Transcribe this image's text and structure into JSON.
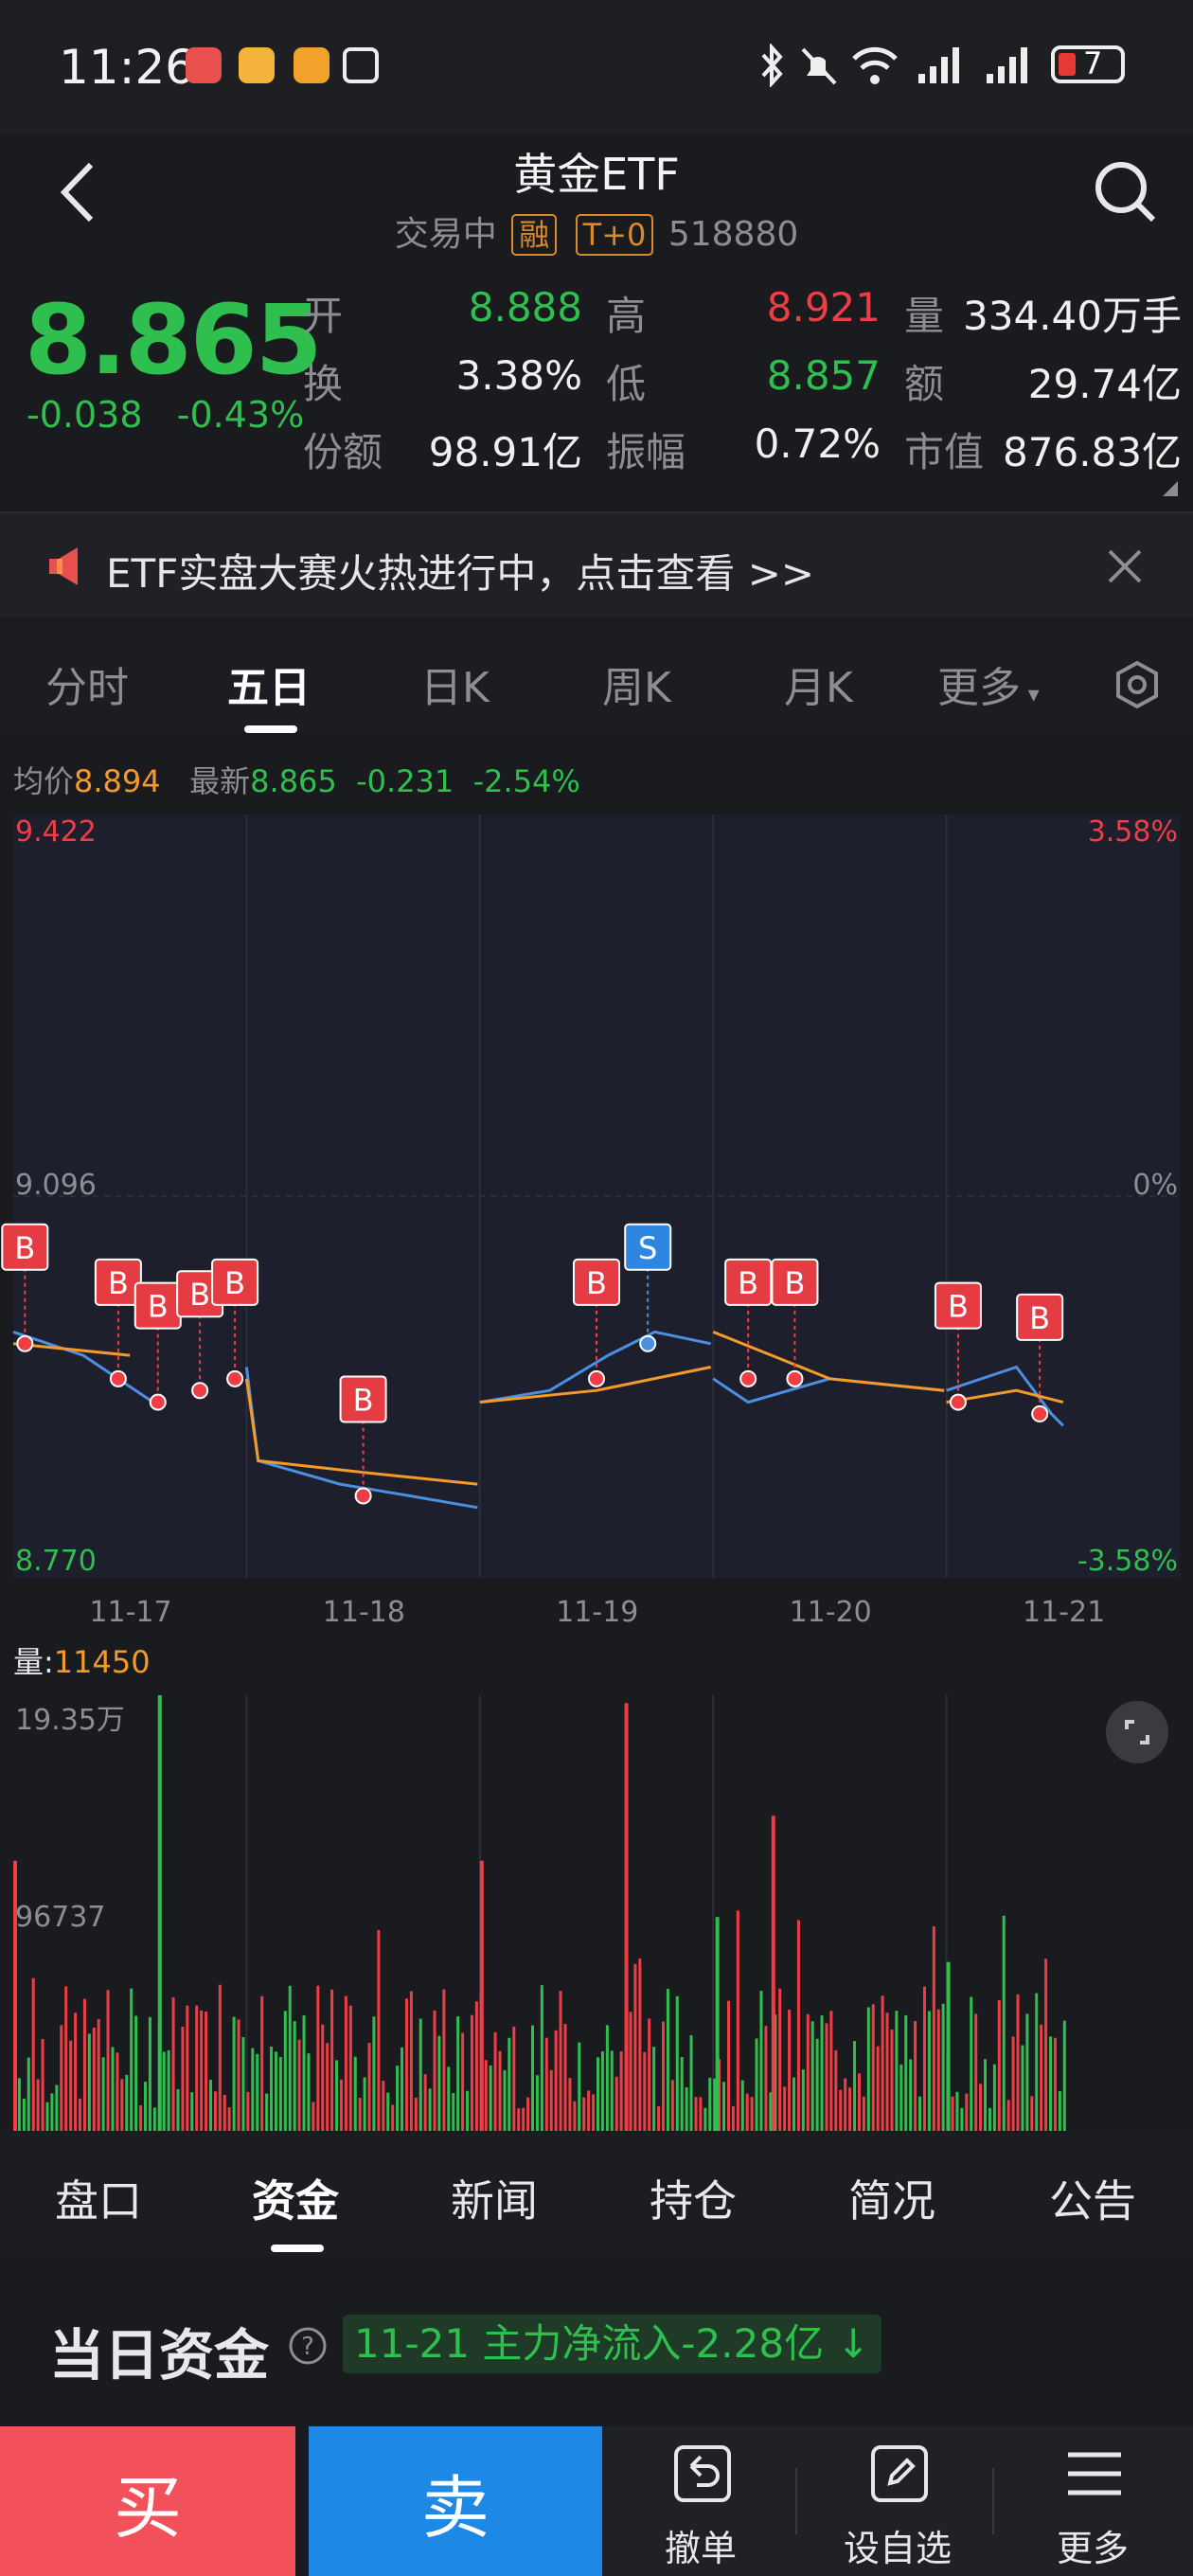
{
  "status_bar": {
    "time": "11:26",
    "battery": "7"
  },
  "header": {
    "title": "黄金ETF",
    "status": "交易中",
    "tag_margin": "融",
    "tag_t0": "T+0",
    "code": "518880"
  },
  "quote": {
    "price": "8.865",
    "change": "-0.038",
    "change_pct": "-0.43%",
    "fields": [
      {
        "label": "开",
        "value": "8.888",
        "color": "green"
      },
      {
        "label": "高",
        "value": "8.921",
        "color": "red"
      },
      {
        "label": "量",
        "value": "334.40万手",
        "color": "white"
      },
      {
        "label": "换",
        "value": "3.38%",
        "color": "white"
      },
      {
        "label": "低",
        "value": "8.857",
        "color": "green"
      },
      {
        "label": "额",
        "value": "29.74亿",
        "color": "white"
      },
      {
        "label": "份额",
        "value": "98.91亿",
        "color": "white"
      },
      {
        "label": "振幅",
        "value": "0.72%",
        "color": "white"
      },
      {
        "label": "市值",
        "value": "876.83亿",
        "color": "white"
      }
    ]
  },
  "banner": {
    "text": "ETF实盘大赛火热进行中，点击查看 >>"
  },
  "chart_tabs": [
    "分时",
    "五日",
    "日K",
    "周K",
    "月K",
    "更多"
  ],
  "chart_tabs_active": 1,
  "price_info": {
    "avg_label": "均价",
    "avg_value": "8.894",
    "latest_label": "最新",
    "latest_value": "8.865",
    "latest_change": "-0.231",
    "latest_pct": "-2.54%"
  },
  "volume_info": {
    "label": "量:",
    "value": "11450"
  },
  "chart_data": [
    {
      "type": "line",
      "dates": [
        "11-17",
        "11-18",
        "11-19",
        "11-20",
        "11-21"
      ],
      "y_ticks_left": [
        "9.422",
        "9.096",
        "8.770"
      ],
      "y_ticks_right": [
        "3.58%",
        "0%",
        "-3.58%"
      ],
      "ylim": [
        8.77,
        9.422
      ],
      "grid": true,
      "series": [
        {
          "role": "price",
          "color": "#4a90e2",
          "x": [
            0,
            0.3,
            0.6,
            1.0,
            1.05,
            1.4,
            1.7,
            1.99,
            2.0,
            2.3,
            2.55,
            2.75,
            2.99,
            3.0,
            3.15,
            3.5,
            3.99,
            4.0,
            4.3,
            4.45,
            4.5
          ],
          "y": [
            8.98,
            8.96,
            8.92,
            8.95,
            8.87,
            8.85,
            8.84,
            8.83,
            8.92,
            8.93,
            8.96,
            8.98,
            8.97,
            8.94,
            8.92,
            8.94,
            8.93,
            8.93,
            8.95,
            8.91,
            8.9
          ]
        },
        {
          "role": "average",
          "color": "#f39a2b",
          "x": [
            0,
            0.5,
            1.0,
            1.05,
            1.5,
            1.99,
            2.0,
            2.5,
            2.99,
            3.0,
            3.5,
            3.99,
            4.0,
            4.3,
            4.5
          ],
          "y": [
            8.97,
            8.96,
            8.94,
            8.87,
            8.86,
            8.85,
            8.92,
            8.93,
            8.95,
            8.98,
            8.94,
            8.93,
            8.92,
            8.93,
            8.92
          ]
        }
      ],
      "annotations": [
        {
          "label": "B",
          "x": 0.05,
          "y": 8.97
        },
        {
          "label": "B",
          "x": 0.45,
          "y": 8.94
        },
        {
          "label": "B",
          "x": 0.62,
          "y": 8.92
        },
        {
          "label": "B",
          "x": 0.8,
          "y": 8.93
        },
        {
          "label": "B",
          "x": 0.95,
          "y": 8.94
        },
        {
          "label": "B",
          "x": 1.5,
          "y": 8.84
        },
        {
          "label": "B",
          "x": 2.5,
          "y": 8.94
        },
        {
          "label": "S",
          "x": 2.72,
          "y": 8.97
        },
        {
          "label": "B",
          "x": 3.15,
          "y": 8.94
        },
        {
          "label": "B",
          "x": 3.35,
          "y": 8.94
        },
        {
          "label": "B",
          "x": 4.05,
          "y": 8.92
        },
        {
          "label": "B",
          "x": 4.4,
          "y": 8.91
        }
      ]
    },
    {
      "type": "bar",
      "title": "量",
      "y_ticks": [
        "19.35万",
        "96737"
      ],
      "ylim": [
        0,
        193500
      ],
      "spikes": [
        {
          "x": 0.0,
          "value": 120000,
          "color": "red"
        },
        {
          "x": 0.62,
          "value": 193500,
          "color": "green"
        },
        {
          "x": 2.0,
          "value": 120000,
          "color": "red"
        },
        {
          "x": 2.62,
          "value": 190000,
          "color": "red"
        },
        {
          "x": 3.25,
          "value": 140000,
          "color": "red"
        },
        {
          "x": 3.01,
          "value": 95000,
          "color": "green"
        },
        {
          "x": 4.0,
          "value": 75000,
          "color": "green"
        }
      ]
    }
  ],
  "info_tabs": [
    "盘口",
    "资金",
    "新闻",
    "持仓",
    "简况",
    "公告"
  ],
  "info_tabs_active": 1,
  "fund": {
    "title": "当日资金",
    "badge": "11-21 主力净流入-2.28亿"
  },
  "actions": {
    "buy": "买",
    "sell": "卖",
    "items": [
      {
        "label": "撤单",
        "icon": "undo-icon"
      },
      {
        "label": "设自选",
        "icon": "edit-icon"
      },
      {
        "label": "更多",
        "icon": "menu-icon"
      }
    ]
  }
}
